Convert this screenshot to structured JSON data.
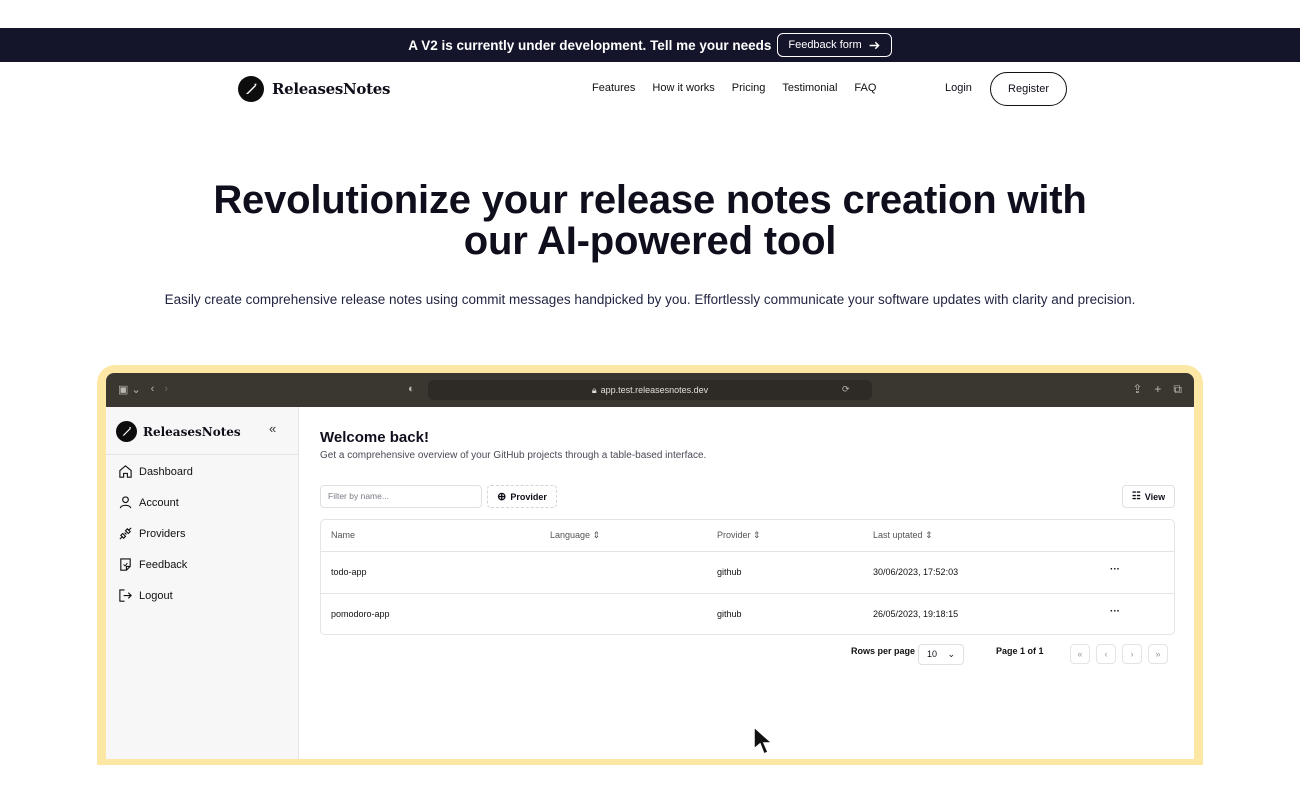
{
  "announcement": {
    "text": "A V2 is currently under development. Tell me your needs",
    "button_label": "Feedback form"
  },
  "nav": {
    "brand": "ReleasesNotes",
    "links": [
      "Features",
      "How it works",
      "Pricing",
      "Testimonial",
      "FAQ"
    ],
    "login": "Login",
    "register": "Register"
  },
  "hero": {
    "title_line1": "Revolutionize your release notes creation with",
    "title_line2": "our AI-powered tool",
    "subtitle": "Easily create comprehensive release notes using commit messages handpicked by you. Effortlessly communicate your software updates with clarity and precision."
  },
  "browser": {
    "url": "app.test.releasesnotes.dev"
  },
  "app": {
    "brand": "ReleasesNotes",
    "sidebar": [
      {
        "label": "Dashboard",
        "icon": "home-icon"
      },
      {
        "label": "Account",
        "icon": "user-icon"
      },
      {
        "label": "Providers",
        "icon": "plug-icon"
      },
      {
        "label": "Feedback",
        "icon": "note-icon"
      },
      {
        "label": "Logout",
        "icon": "logout-icon"
      }
    ],
    "welcome_title": "Welcome back!",
    "welcome_sub": "Get a comprehensive overview of your GitHub projects through a table-based interface.",
    "filter_placeholder": "Filter by name...",
    "provider_button": "Provider",
    "view_button": "View",
    "table": {
      "headers": [
        "Name",
        "Language",
        "Provider",
        "Last uptated"
      ],
      "rows": [
        {
          "name": "todo-app",
          "language": "",
          "provider": "github",
          "updated": "30/06/2023, 17:52:03"
        },
        {
          "name": "pomodoro-app",
          "language": "",
          "provider": "github",
          "updated": "26/05/2023, 19:18:15"
        }
      ]
    },
    "pagination": {
      "rows_label": "Rows per page",
      "rows_value": "10",
      "page_label": "Page 1 of 1"
    }
  }
}
